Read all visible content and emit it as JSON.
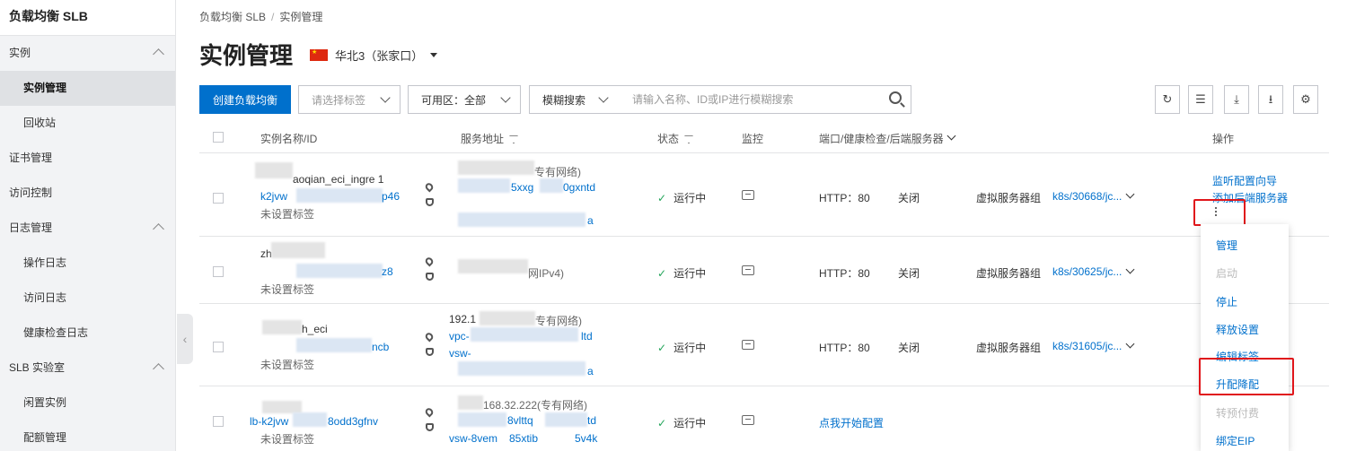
{
  "sidebar": {
    "title": "负载均衡 SLB",
    "items": [
      {
        "label": "实例",
        "type": "group",
        "expanded": true
      },
      {
        "label": "实例管理",
        "type": "sub",
        "active": true
      },
      {
        "label": "回收站",
        "type": "sub"
      },
      {
        "label": "证书管理",
        "type": "group"
      },
      {
        "label": "访问控制",
        "type": "group"
      },
      {
        "label": "日志管理",
        "type": "group",
        "expanded": true
      },
      {
        "label": "操作日志",
        "type": "sub"
      },
      {
        "label": "访问日志",
        "type": "sub"
      },
      {
        "label": "健康检查日志",
        "type": "sub"
      },
      {
        "label": "SLB 实验室",
        "type": "group",
        "expanded": true
      },
      {
        "label": "闲置实例",
        "type": "sub"
      },
      {
        "label": "配额管理",
        "type": "sub"
      }
    ],
    "collapse_glyph": "‹"
  },
  "breadcrumb": {
    "root": "负载均衡 SLB",
    "sep": "/",
    "current": "实例管理"
  },
  "page_title": "实例管理",
  "region": {
    "label": "华北3（张家口）"
  },
  "toolbar": {
    "create_label": "创建负载均衡",
    "tag_placeholder": "请选择标签",
    "zone_label": "可用区：全部",
    "search_mode": "模糊搜索",
    "search_placeholder": "请输入名称、ID或IP进行模糊搜索",
    "icons": [
      "refresh-icon",
      "list-icon",
      "download-icon",
      "export-icon",
      "settings-icon"
    ],
    "icon_glyphs": [
      "↻",
      "☰",
      "⤓",
      "⭳",
      "⚙"
    ]
  },
  "table": {
    "headers": {
      "name": "实例名称/ID",
      "address": "服务地址",
      "status": "状态",
      "monitor": "监控",
      "ports": "端口/健康检查/后端服务器",
      "actions": "操作"
    },
    "rows": [
      {
        "name": "aoqian_eci_ingre 1",
        "id": "k2jvw",
        "id_tail": "p46",
        "tag": "未设置标签",
        "addr1": "专有网络)",
        "addr2_a": "5xxg",
        "addr2_b": "0gxntd",
        "addr3": "a",
        "status": "运行中",
        "port": "HTTP：80",
        "health": "关闭",
        "backend_type": "虚拟服务器组",
        "backend": "k8s/30668/jc...",
        "action1": "监听配置向导",
        "action2": "添加后端服务器"
      },
      {
        "name": "zh",
        "id_tail": "z8",
        "tag": "未设置标签",
        "addr1": "网IPv4)",
        "status": "运行中",
        "port": "HTTP：80",
        "health": "关闭",
        "backend_type": "虚拟服务器组",
        "backend": "k8s/30625/jc..."
      },
      {
        "name": "h_eci",
        "id_tail": "ncb",
        "tag": "未设置标签",
        "addr1_a": "192.1",
        "addr1_b": "专有网络)",
        "addr2_a": "vpc-",
        "addr2_b": "ltd",
        "addr3": "vsw-",
        "addr4": "a",
        "status": "运行中",
        "port": "HTTP：80",
        "health": "关闭",
        "backend_type": "虚拟服务器组",
        "backend": "k8s/31605/jc..."
      },
      {
        "id_a": "lb-k2jvw",
        "id_b": "8odd3gfnv",
        "tag": "未设置标签",
        "addr1": "168.32.222(专有网络)",
        "addr2_a": "8vlttq",
        "addr2_b": "td",
        "addr3": "vsw-8vem",
        "addr3_b": "85xtib",
        "addr3_c": "5v4k",
        "status": "运行中",
        "config_link": "点我开始配置"
      }
    ]
  },
  "menu": {
    "items": [
      {
        "label": "管理",
        "disabled": false
      },
      {
        "label": "启动",
        "disabled": true
      },
      {
        "label": "停止",
        "disabled": false
      },
      {
        "label": "释放设置",
        "disabled": false
      },
      {
        "label": "编辑标签",
        "disabled": false
      },
      {
        "label": "升配降配",
        "disabled": false,
        "highlighted": true
      },
      {
        "label": "转预付费",
        "disabled": true
      },
      {
        "label": "绑定EIP",
        "disabled": false
      }
    ]
  },
  "colors": {
    "primary": "#0070cc",
    "highlight": "#e0161b",
    "success": "#23a55a"
  }
}
